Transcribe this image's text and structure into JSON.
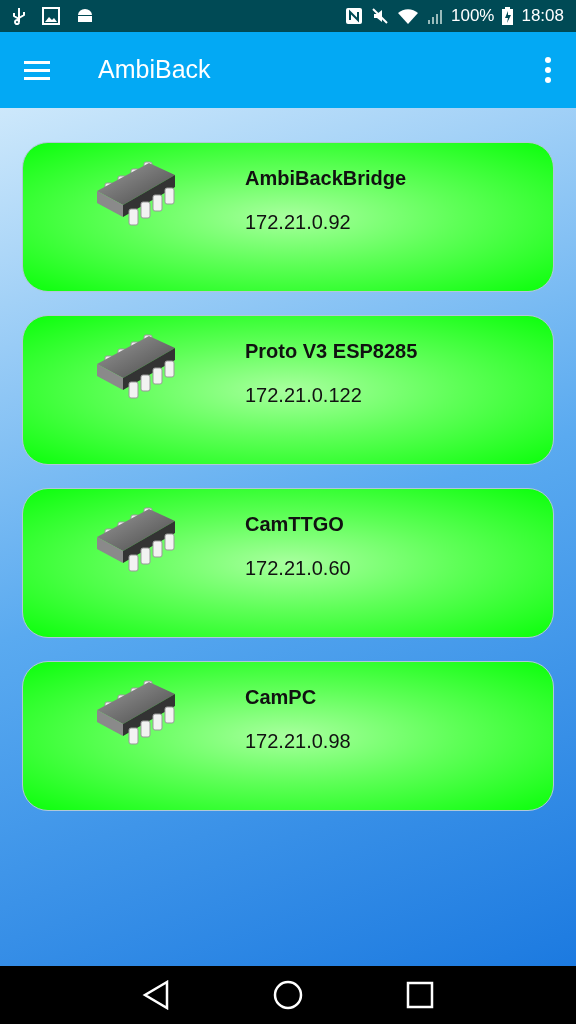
{
  "status_bar": {
    "battery": "100%",
    "time": "18:08"
  },
  "app_bar": {
    "title": "AmbiBack"
  },
  "devices": [
    {
      "name": "AmbiBackBridge",
      "ip": "172.21.0.92"
    },
    {
      "name": "Proto V3 ESP8285",
      "ip": "172.21.0.122"
    },
    {
      "name": "CamTTGO",
      "ip": "172.21.0.60"
    },
    {
      "name": "CamPC",
      "ip": "172.21.0.98"
    }
  ]
}
